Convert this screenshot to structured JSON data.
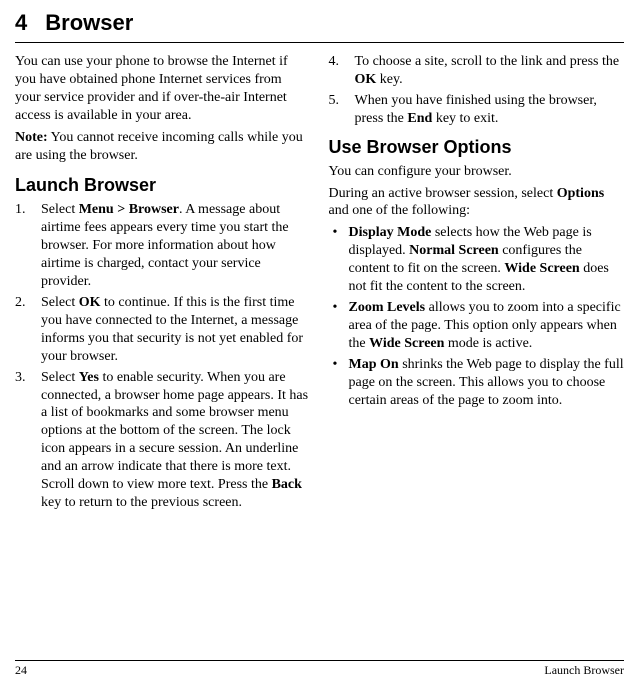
{
  "chapter": {
    "num": "4",
    "title": "Browser"
  },
  "col1": {
    "intro": "You can use your phone to browse the Internet if you have obtained phone Internet services from your service provider and if over-the-air Internet access is available in your area.",
    "note_label": "Note:",
    "note_body": " You cannot receive incoming calls while you are using the browser.",
    "launch_h": "Launch Browser",
    "s1a": "Select ",
    "s1b": "Menu > Browser",
    "s1c": ". A message about airtime fees appears every time you start the browser. For more information about how airtime is charged, contact your service provider.",
    "s2a": "Select ",
    "s2b": "OK",
    "s2c": " to continue. If this is the first time you have connected to the Internet, a message informs you that security is not yet enabled for your browser.",
    "s3a": "Select ",
    "s3b": "Yes",
    "s3c": " to enable security. When you are connected, a browser home page appears. It has a list of bookmarks and some browser menu options at the bottom of the screen. The lock icon appears in a secure session. An underline and an arrow indicate that there is more text. Scroll down to view more text. Press the ",
    "s3d": "Back",
    "s3e": " key to return to the previous screen."
  },
  "col2": {
    "s4a": "To choose a site, scroll to the link and press the ",
    "s4b": "OK",
    "s4c": " key.",
    "s5a": "When you have finished using the browser, press the ",
    "s5b": "End",
    "s5c": " key to exit.",
    "options_h": "Use Browser Options",
    "opt_p1": "You can configure your browser.",
    "opt_p2a": "During an active browser session, select ",
    "opt_p2b": "Options",
    "opt_p2c": " and one of the following:",
    "b1a": "Display Mode",
    "b1b": " selects how the Web page is displayed. ",
    "b1c": "Normal Screen",
    "b1d": " configures the content to fit on the screen. ",
    "b1e": "Wide Screen",
    "b1f": " does not fit the content to the screen.",
    "b2a": "Zoom Levels",
    "b2b": " allows you to zoom into a specific area of the page. This option only appears when the ",
    "b2c": "Wide Screen",
    "b2d": " mode is active.",
    "b3a": "Map On",
    "b3b": " shrinks the Web page to display the full page on the screen. This allows you to choose certain areas of the page to zoom into."
  },
  "footer": {
    "page": "24",
    "section": "Launch Browser"
  }
}
